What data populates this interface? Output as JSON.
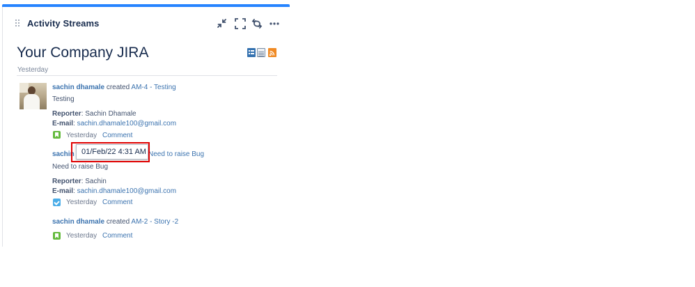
{
  "gadget": {
    "title": "Activity Streams",
    "heading": "Your Company JIRA",
    "toolbar": {
      "minimize_icon": "minimize-icon",
      "fullscreen_icon": "fullscreen-icon",
      "refresh_icon": "refresh-icon",
      "more_icon": "more-icon"
    },
    "view_icons": [
      "list-view-icon",
      "full-view-icon",
      "rss-feed-icon"
    ],
    "accent_color": "#2684ff"
  },
  "stream": {
    "day_label": "Yesterday",
    "entries": [
      {
        "user": "sachin dhamale",
        "action": "created",
        "issue_link": "AM-4 - Testing",
        "description": "Testing",
        "reporter_label": "Reporter",
        "reporter_value": ": Sachin Dhamale",
        "email_label": "E-mail",
        "email_sep": ": ",
        "email_value": "sachin.dhamale100@gmail.com",
        "type_icon": "story-icon",
        "time": "Yesterday",
        "comment_label": "Comment"
      },
      {
        "user_partial": "sachin",
        "issue_link_partial": "Need to raise Bug",
        "description": "Need to raise Bug",
        "reporter_label": "Reporter",
        "reporter_value": ": Sachin",
        "email_label": "E-mail",
        "email_sep": ": ",
        "email_value": "sachin.dhamale100@gmail.com",
        "type_icon": "task-icon",
        "time": "Yesterday",
        "comment_label": "Comment"
      },
      {
        "user": "sachin dhamale",
        "action": "created",
        "issue_link": "AM-2 - Story -2",
        "type_icon": "story-icon",
        "time": "Yesterday",
        "comment_label": "Comment"
      }
    ]
  },
  "tooltip": {
    "text": "01/Feb/22 4:31 AM",
    "highlight_color": "#e00000"
  }
}
